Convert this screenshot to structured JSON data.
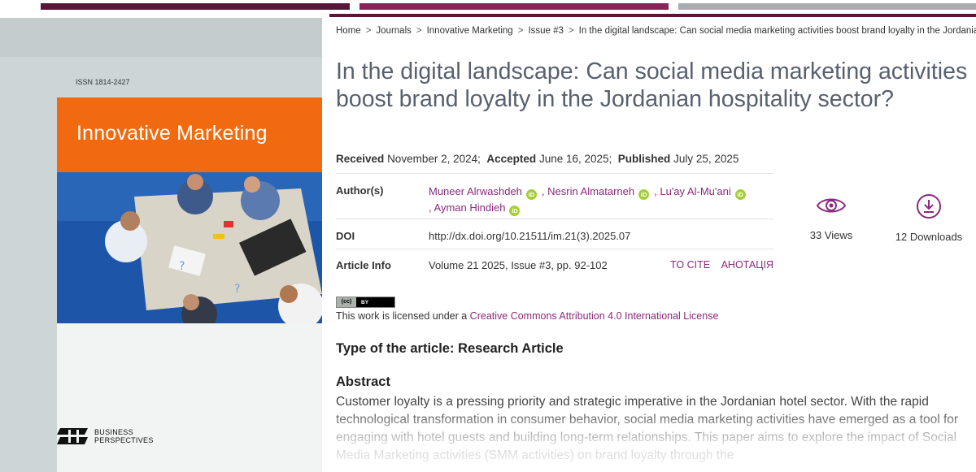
{
  "cover": {
    "issn": "ISSN 1814-2427",
    "journal_title": "Innovative Marketing",
    "publisher_line1": "BUSINESS",
    "publisher_line2": "PERSPECTIVES"
  },
  "breadcrumb": [
    "Home",
    "Journals",
    "Innovative Marketing",
    "Issue #3",
    "In the digital landscape: Can social media marketing activities boost brand loyalty in the Jordanian hospitality sector?"
  ],
  "article": {
    "title": "In the digital landscape: Can social media marketing activities boost brand loyalty in the Jordanian hospitality sector?",
    "received_label": "Received",
    "received_date": "November 2, 2024;",
    "accepted_label": "Accepted",
    "accepted_date": "June 16, 2025;",
    "published_label": "Published",
    "published_date": "July 25, 2025"
  },
  "info": {
    "authors_label": "Author(s)",
    "authors": [
      "Muneer Alrwashdeh",
      "Nesrin Almatarneh",
      "Lu'ay Al-Mu'ani",
      "Ayman Hindieh"
    ],
    "author_separator": ",",
    "orcid_icon_text": "iD",
    "doi_label": "DOI",
    "doi_value": "http://dx.doi.org/10.21511/im.21(3).2025.07",
    "article_info_label": "Article Info",
    "article_info_value": "Volume 21 2025, Issue #3, pp. 92-102",
    "to_cite": "TO CITE",
    "annotation": "АНОТАЦІЯ"
  },
  "stats": {
    "views": "33 Views",
    "downloads": "12 Downloads"
  },
  "license": {
    "badge_left": "(cc)",
    "badge_right": "BY",
    "prefix": "This work is licensed under a",
    "link_text": "Creative Commons Attribution 4.0 International License"
  },
  "type_of_article": "Type of the article: Research Article",
  "abstract": {
    "heading": "Abstract",
    "text": "Customer loyalty is a pressing priority and strategic imperative in the Jordanian hotel sector. With the rapid technological transformation in consumer behavior, social media marketing activities have emerged as a tool for engaging with hotel guests and building long-term relationships. This paper aims to explore the impact of Social Media Marketing activities (SMM activities) on brand loyalty through the"
  },
  "colors": {
    "accent_purple": "#8a2a7c",
    "title_gray": "#56606e",
    "cover_orange": "#f26a10",
    "stripe_dark": "#5a1638",
    "orcid_green": "#a6ce39"
  }
}
